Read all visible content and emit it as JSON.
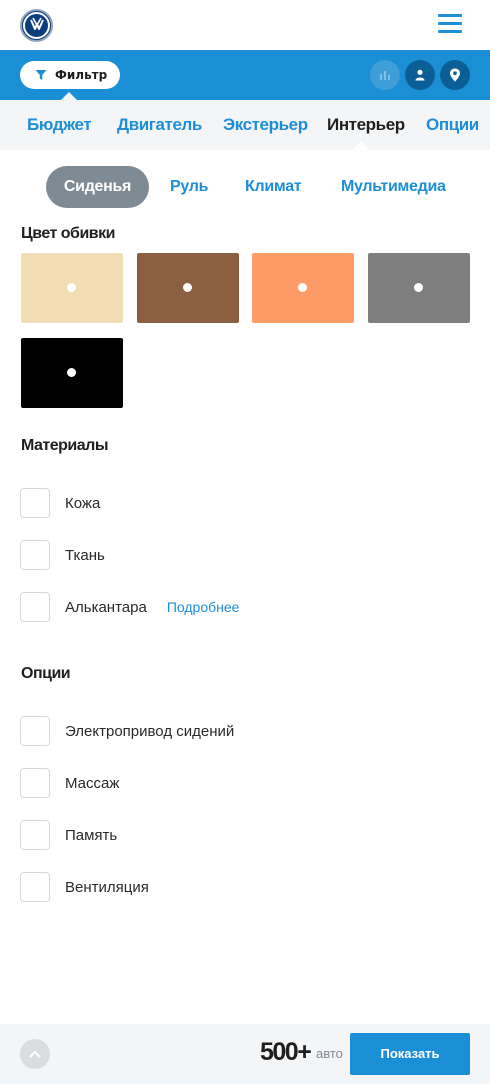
{
  "header": {
    "logo_icon": "volkswagen-logo",
    "menu_icon": "hamburger-menu-icon"
  },
  "filter_bar": {
    "filter_label": "Фильтр",
    "filter_icon": "funnel-icon",
    "actions": [
      {
        "icon": "bar-chart-icon",
        "enabled": false
      },
      {
        "icon": "user-icon",
        "enabled": true
      },
      {
        "icon": "map-pin-icon",
        "enabled": true
      }
    ]
  },
  "tabs": [
    {
      "label": "Бюджет",
      "active": false
    },
    {
      "label": "Двигатель",
      "active": false
    },
    {
      "label": "Экстерьер",
      "active": false
    },
    {
      "label": "Интерьер",
      "active": true
    },
    {
      "label": "Опции",
      "active": false
    }
  ],
  "subtabs": [
    {
      "label": "Сиденья",
      "active": true
    },
    {
      "label": "Руль",
      "active": false
    },
    {
      "label": "Климат",
      "active": false
    },
    {
      "label": "Мультимедиа",
      "active": false
    }
  ],
  "upholstery": {
    "title": "Цвет обивки",
    "colors": [
      "#f2dcb3",
      "#8c5e42",
      "#ff9b66",
      "#7f7f7f",
      "#000000"
    ]
  },
  "materials": {
    "title": "Материалы",
    "items": [
      {
        "label": "Кожа",
        "checked": false
      },
      {
        "label": "Ткань",
        "checked": false
      },
      {
        "label": "Алькантара",
        "checked": false
      }
    ],
    "more_link": "Подробнее"
  },
  "options": {
    "title": "Опции",
    "items": [
      {
        "label": "Электропривод сидений",
        "checked": false
      },
      {
        "label": "Массаж",
        "checked": false
      },
      {
        "label": "Память",
        "checked": false
      },
      {
        "label": "Вентиляция",
        "checked": false
      }
    ]
  },
  "footer": {
    "up_icon": "chevron-up-icon",
    "count": "500+",
    "count_unit": "авто",
    "show_label": "Показать"
  },
  "colors": {
    "accent": "#1a8fd6",
    "accent_dark": "#0c5f96",
    "active_pill": "#7e8a94",
    "panel_bg": "#f4f5f6"
  }
}
